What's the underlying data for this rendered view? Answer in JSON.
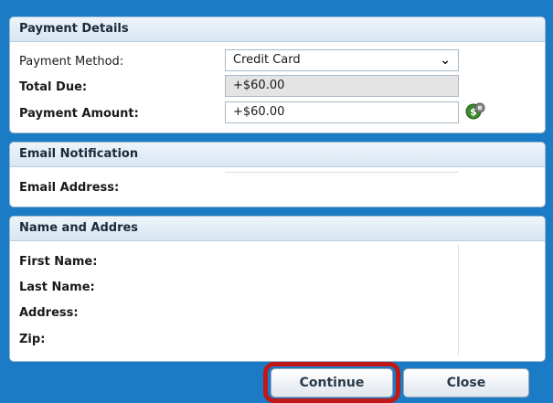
{
  "payment": {
    "header": "Payment Details",
    "method_label": "Payment Method:",
    "method_value": "Credit Card",
    "total_label": "Total Due:",
    "total_value": "+$60.00",
    "amount_label": "Payment Amount:",
    "amount_value": "+$60.00"
  },
  "email": {
    "header": "Email Notification",
    "address_label": "Email Address:",
    "address_value": ""
  },
  "name_address": {
    "header": "Name and Addres",
    "first_name_label": "First Name:",
    "last_name_label": "Last Name:",
    "address_label": "Address:",
    "zip_label": "Zip:"
  },
  "buttons": {
    "continue_label": "Continue",
    "close_label": "Close"
  },
  "icons": {
    "dropdown": "chevron-down-icon",
    "calculator": "money-calculator-icon"
  },
  "colors": {
    "background": "#1b7bc4",
    "highlight": "#c01818"
  }
}
